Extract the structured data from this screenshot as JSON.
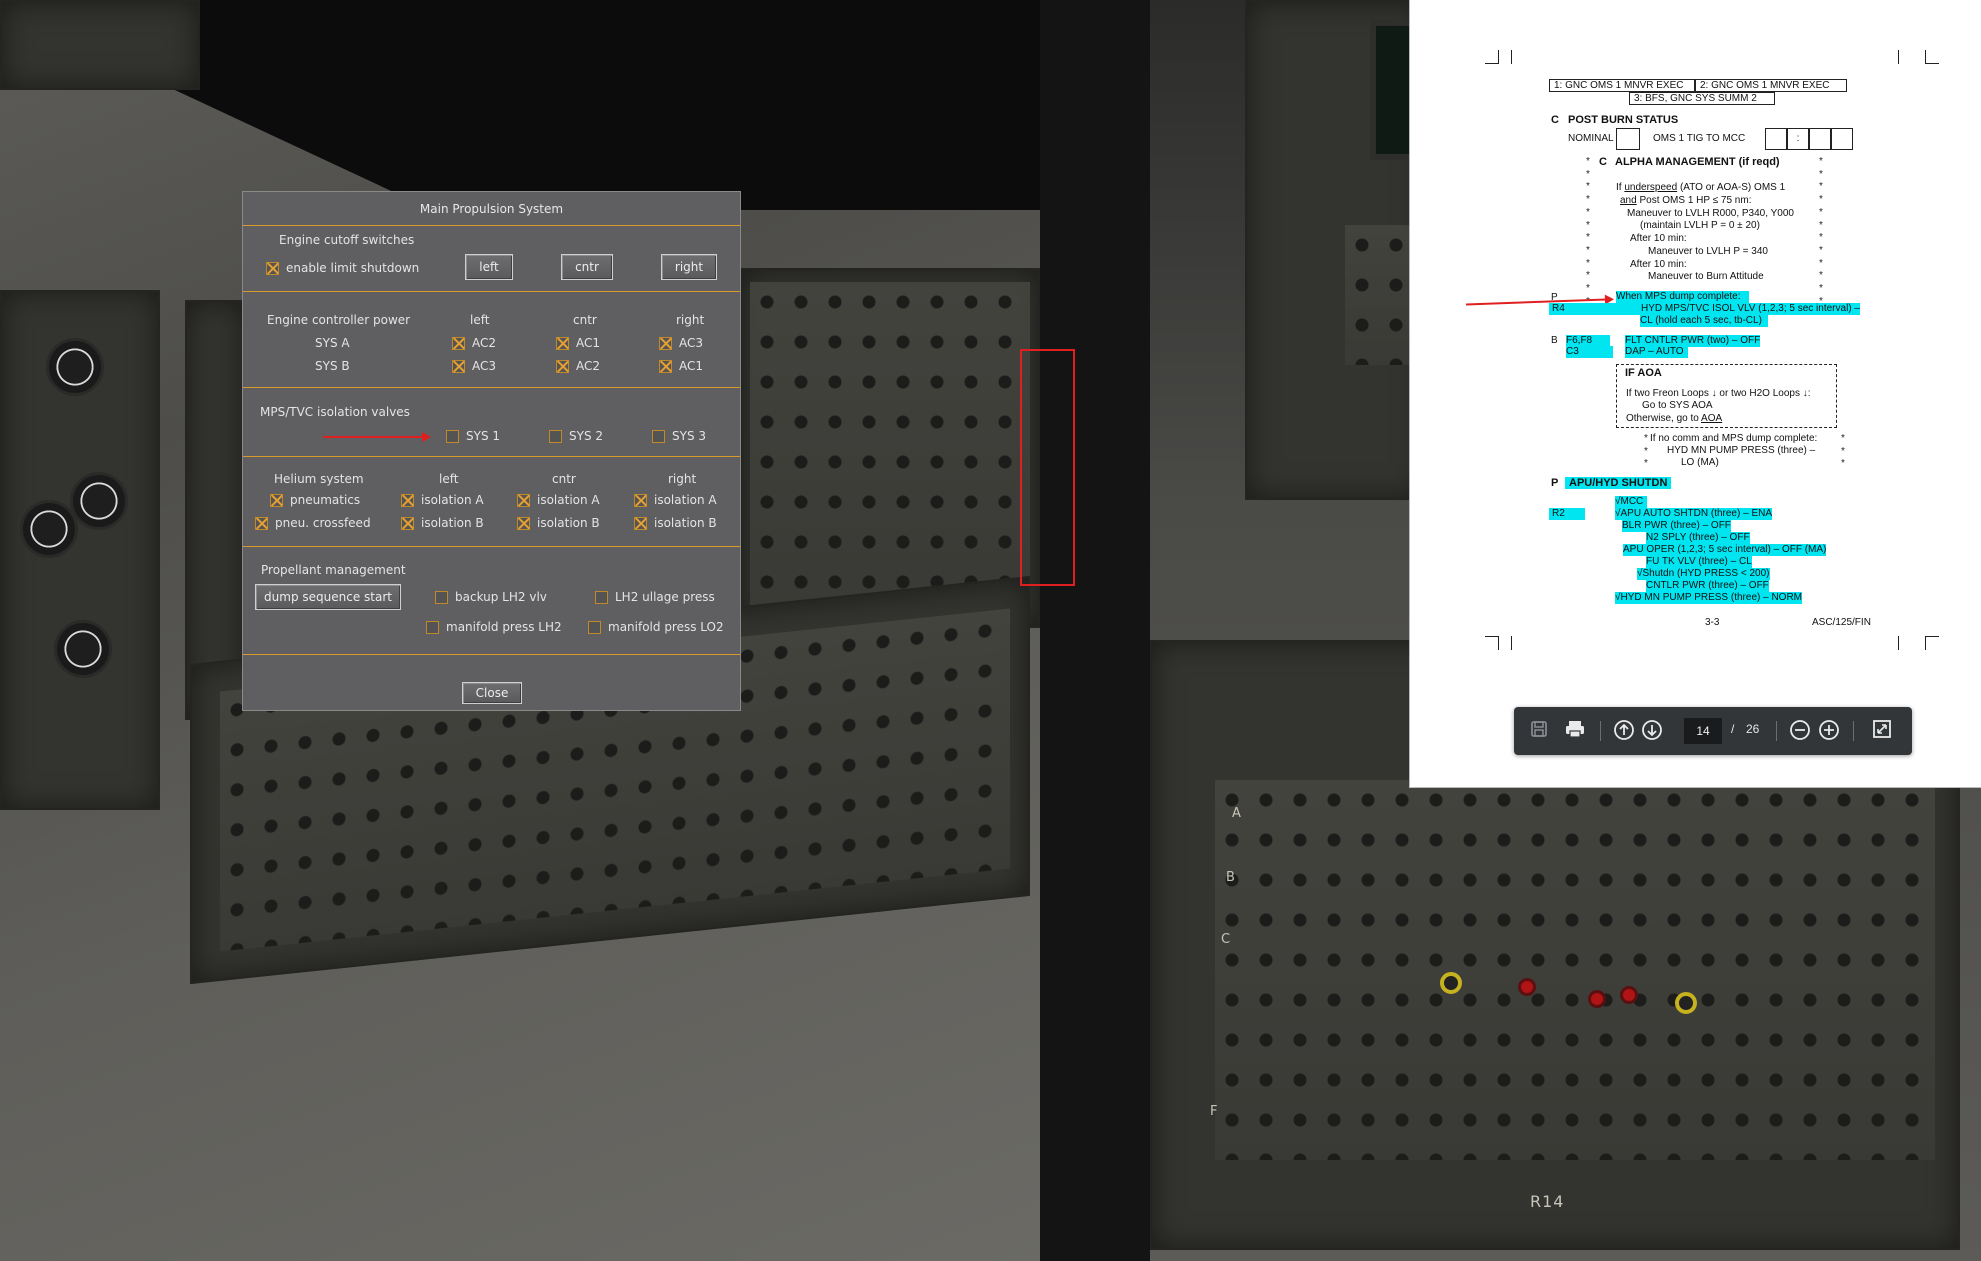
{
  "dialog": {
    "title": "Main Propulsion System",
    "cutoff": {
      "heading": "Engine cutoff switches",
      "enable_label": "enable limit shutdown",
      "enable_checked": true,
      "buttons": [
        "left",
        "cntr",
        "right"
      ]
    },
    "controller": {
      "heading": "Engine controller power",
      "columns": [
        "left",
        "cntr",
        "right"
      ],
      "rows": [
        {
          "label": "SYS A",
          "cells": [
            "AC2",
            "AC1",
            "AC3"
          ]
        },
        {
          "label": "SYS B",
          "cells": [
            "AC3",
            "AC2",
            "AC1"
          ]
        }
      ]
    },
    "isolation": {
      "heading": "MPS/TVC isolation valves",
      "items": [
        "SYS 1",
        "SYS 2",
        "SYS 3"
      ]
    },
    "helium": {
      "heading": "Helium system",
      "columns": [
        "left",
        "cntr",
        "right"
      ],
      "pneumatics": "pneumatics",
      "crossfeed": "pneu. crossfeed",
      "iso_a": "isolation A",
      "iso_b": "isolation B"
    },
    "propellant": {
      "heading": "Propellant management",
      "dump_button": "dump sequence start",
      "options": [
        "backup LH2 vlv",
        "LH2 ullage press",
        "manifold press LH2",
        "manifold press LO2"
      ]
    },
    "close_button": "Close"
  },
  "pdf": {
    "header_boxes": [
      "1:  GNC OMS 1 MNVR EXEC",
      "2:  GNC OMS 1 MNVR EXEC",
      "3:  BFS, GNC SYS SUMM 2"
    ],
    "post_burn": {
      "letter": "C",
      "title": "POST BURN STATUS",
      "nominal": "NOMINAL",
      "oms": "OMS 1 TIG TO MCC",
      "colon": ":"
    },
    "alpha": {
      "letter": "C",
      "title": "ALPHA MANAGEMENT (if reqd)",
      "lines": [
        "If",
        "underspeed",
        "(ATO or AOA-S) OMS 1",
        "and",
        "Post OMS 1 HP ≤ 75 nm:",
        "Maneuver to LVLH R000, P340, Y000",
        "(maintain LVLH P = 0 ± 20)",
        "After 10 min:",
        "Maneuver to LVLH P = 340",
        "After 10 min:",
        "Maneuver to Burn Attitude"
      ]
    },
    "dump": {
      "letter": "P",
      "title": "When MPS dump complete:",
      "r4": "R4",
      "r4_line1": "HYD MPS/TVC ISOL VLV (1,2,3; 5 sec interval) –",
      "r4_line2": "CL (hold each 5 sec, tb-CL)",
      "b_letter": "B",
      "b_panel1": "F6,F8",
      "b_panel2": "C3",
      "b_line1": "FLT CNTLR PWR (two) – OFF",
      "b_line2": "DAP – AUTO"
    },
    "aoa": {
      "title": "IF AOA",
      "line1": "If two Freon Loops ↓ or two H2O Loops ↓:",
      "line2": "Go to SYS AOA",
      "line3": "Otherwise, go to",
      "line3_link": "AOA"
    },
    "no_comm": {
      "line1": "If no comm and MPS dump complete:",
      "line2": "HYD MN PUMP PRESS (three) –",
      "line3": "LO (MA)"
    },
    "apu": {
      "letter": "P",
      "title": "APU/HYD SHUTDN",
      "r2": "R2",
      "lines": [
        "√MCC",
        "√APU AUTO SHTDN (three) – ENA",
        "BLR PWR (three)                 – OFF",
        "N2 SPLY (three)         – OFF",
        "APU OPER (1,2,3; 5 sec interval) – OFF (MA)",
        "FU TK VLV (three) – CL",
        "√Shutdn (HYD PRESS < 200)",
        "CNTLR PWR (three) – OFF",
        "√HYD MN PUMP PRESS (three) – NORM"
      ]
    },
    "footer": {
      "page": "3-3",
      "doc": "ASC/125/FIN"
    },
    "toolbar": {
      "current_page": "14",
      "separator": "/",
      "total_pages": "26"
    }
  },
  "cockpit_labels": {
    "r14": "R14",
    "rows": [
      "A",
      "B",
      "C",
      "F"
    ]
  }
}
